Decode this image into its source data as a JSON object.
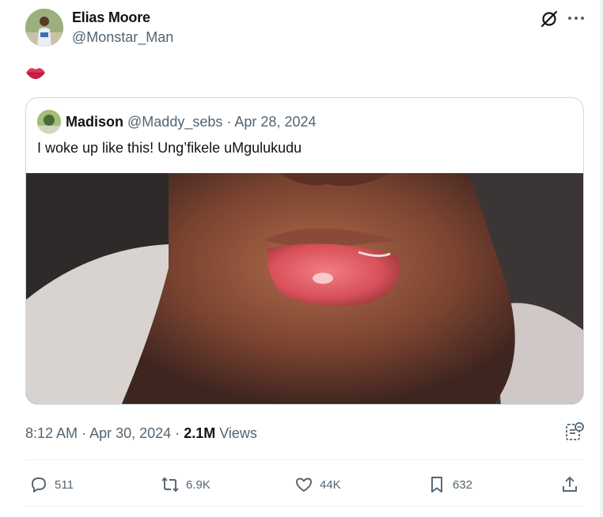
{
  "author": {
    "name": "Elias Moore",
    "handle": "@Monstar_Man"
  },
  "post": {
    "emoji": "lips-emoji"
  },
  "quoted": {
    "name": "Madison",
    "handle": "@Maddy_sebs",
    "date": "Apr 28, 2024",
    "text": "I woke up like this! Ung’fikele uMgulukudu"
  },
  "meta": {
    "time": "8:12 AM",
    "date": "Apr 30, 2024",
    "views_count": "2.1M",
    "views_label": "Views"
  },
  "actions": {
    "replies": "511",
    "reposts": "6.9K",
    "likes": "44K",
    "bookmarks": "632"
  },
  "colors": {
    "text": "#0f1419",
    "secondary": "#536471",
    "border": "#cfd9de"
  },
  "icons": [
    "grok-icon",
    "more-icon",
    "reply-icon",
    "repost-icon",
    "like-icon",
    "bookmark-icon",
    "share-icon",
    "community-notes-icon"
  ]
}
